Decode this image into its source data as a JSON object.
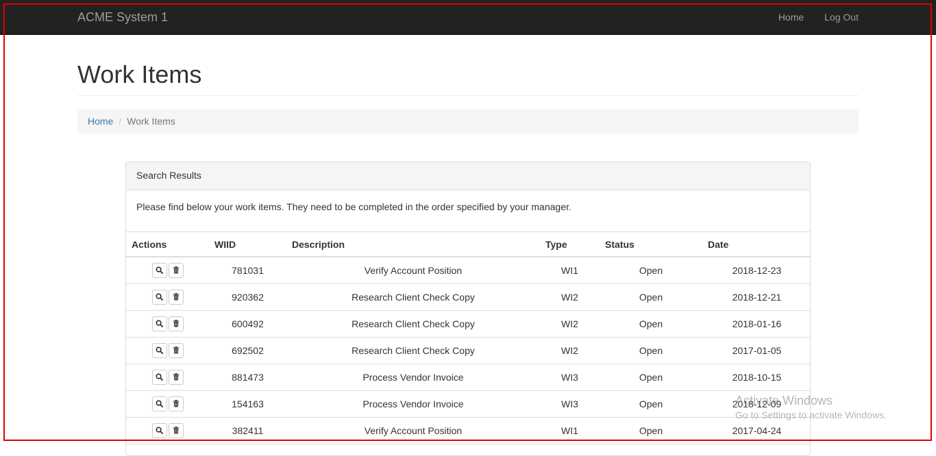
{
  "navbar": {
    "brand": "ACME System 1",
    "links": [
      "Home",
      "Log Out"
    ]
  },
  "page": {
    "title": "Work Items"
  },
  "breadcrumb": {
    "home": "Home",
    "separator": "/",
    "current": "Work Items"
  },
  "panel": {
    "heading": "Search Results",
    "intro": "Please find below your work items. They need to be completed in the order specified by your manager."
  },
  "table": {
    "headers": [
      "Actions",
      "WIID",
      "Description",
      "Type",
      "Status",
      "Date"
    ],
    "rows": [
      {
        "wiid": "781031",
        "description": "Verify Account Position",
        "type": "WI1",
        "status": "Open",
        "date": "2018-12-23"
      },
      {
        "wiid": "920362",
        "description": "Research Client Check Copy",
        "type": "WI2",
        "status": "Open",
        "date": "2018-12-21"
      },
      {
        "wiid": "600492",
        "description": "Research Client Check Copy",
        "type": "WI2",
        "status": "Open",
        "date": "2018-01-16"
      },
      {
        "wiid": "692502",
        "description": "Research Client Check Copy",
        "type": "WI2",
        "status": "Open",
        "date": "2017-01-05"
      },
      {
        "wiid": "881473",
        "description": "Process Vendor Invoice",
        "type": "WI3",
        "status": "Open",
        "date": "2018-10-15"
      },
      {
        "wiid": "154163",
        "description": "Process Vendor Invoice",
        "type": "WI3",
        "status": "Open",
        "date": "2018-12-09"
      },
      {
        "wiid": "382411",
        "description": "Verify Account Position",
        "type": "WI1",
        "status": "Open",
        "date": "2017-04-24"
      }
    ],
    "row_icons": [
      "search-icon",
      "trash-icon"
    ]
  },
  "watermark": {
    "title": "Activate Windows",
    "subtitle": "Go to Settings to activate Windows."
  },
  "colors": {
    "navbar_bg": "#222222",
    "navbar_text": "#9d9d9d",
    "link": "#337ab7",
    "frame": "#e00000"
  }
}
